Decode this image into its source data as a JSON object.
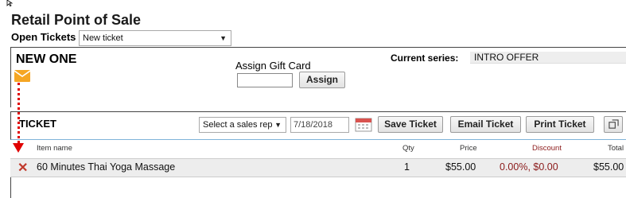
{
  "page": {
    "title": "Retail Point of Sale"
  },
  "open_tickets": {
    "label": "Open Tickets",
    "selected": "New ticket"
  },
  "ticket_name": "NEW ONE",
  "gift_card": {
    "label": "Assign Gift Card",
    "value": "",
    "button": "Assign"
  },
  "series": {
    "label": "Current series:",
    "value": "INTRO OFFER"
  },
  "ticket_bar": {
    "label": "TICKET",
    "sales_rep_placeholder": "Select a sales rep",
    "date": "7/18/2018",
    "save": "Save Ticket",
    "email": "Email Ticket",
    "print": "Print Ticket"
  },
  "table": {
    "headers": {
      "item": "Item name",
      "qty": "Qty",
      "price": "Price",
      "discount": "Discount",
      "total": "Total"
    },
    "rows": [
      {
        "item": "60 Minutes Thai Yoga Massage",
        "qty": "1",
        "price": "$55.00",
        "discount": "0.00%, $0.00",
        "total": "$55.00"
      }
    ]
  },
  "colors": {
    "accent_red": "#e00000",
    "discount_red": "#8b1a1a",
    "envelope": "#f5a623"
  },
  "icons": {
    "envelope": "envelope-icon",
    "calendar": "calendar-icon",
    "remove": "close-icon",
    "expand": "expand-icon"
  }
}
